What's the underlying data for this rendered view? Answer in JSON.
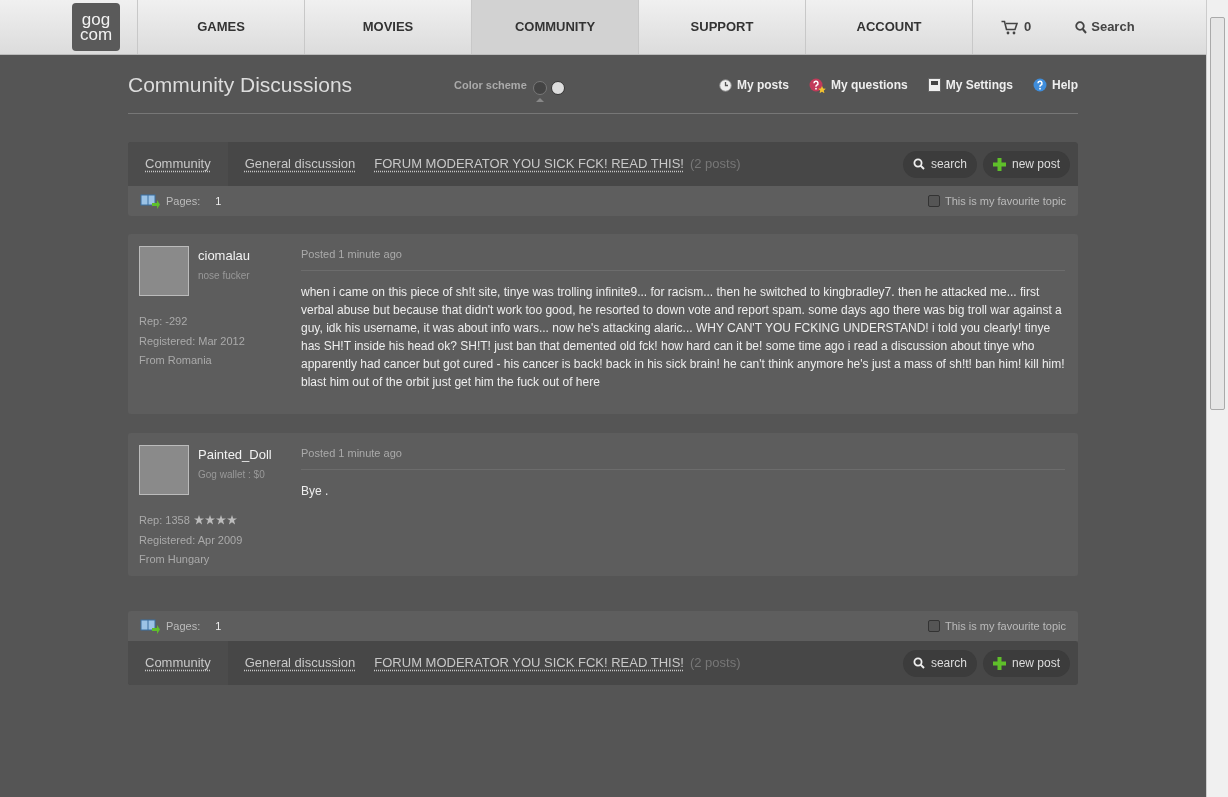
{
  "nav": {
    "logo": [
      "gog",
      "com"
    ],
    "items": [
      {
        "label": "GAMES",
        "selected": false
      },
      {
        "label": "MOVIES",
        "selected": false
      },
      {
        "label": "COMMUNITY",
        "selected": true
      },
      {
        "label": "SUPPORT",
        "selected": false
      },
      {
        "label": "ACCOUNT",
        "selected": false
      }
    ],
    "cart_count": "0",
    "search_label": "Search"
  },
  "header": {
    "title": "Community Discussions",
    "color_scheme": {
      "label": "Color scheme",
      "options": [
        {
          "selected": true
        },
        {
          "selected": false
        }
      ]
    },
    "links": [
      {
        "kind": "posts",
        "label": "My posts"
      },
      {
        "kind": "questions",
        "label": "My questions"
      },
      {
        "kind": "settings",
        "label": "My Settings"
      },
      {
        "kind": "help",
        "label": "Help"
      }
    ]
  },
  "top_nav": {
    "breadcrumbs": [
      "Community",
      "General discussion"
    ],
    "topic": "FORUM MODERATOR YOU SICK FCK! READ THIS!",
    "post_count": "(2 posts)",
    "search_label": "search",
    "new_post_label": "new post",
    "pages_label": "Pages:",
    "page": "1",
    "favourite": {
      "label": "This is my favourite topic",
      "checked": false
    }
  },
  "posts": [
    {
      "username": "ciomalau",
      "subtitle": "nose fucker",
      "rep": "Rep: -292",
      "registered": "Registered: Mar 2012",
      "from": "From Romania",
      "posted": "Posted 1 minute ago",
      "body": "when i came on this piece of sh!t site, tinye was trolling infinite9... for racism... then he switched to kingbradley7. then he attacked me... first verbal abuse but because that didn't work too good, he resorted to down vote and report spam. some days ago there was big troll war against a guy, idk his username, it was about info wars... now he's attacking alaric... WHY CAN'T YOU FCKING UNDERSTAND! i told you clearly! tinye has SH!T inside his head ok? SH!T! just ban that demented old fck! how hard can it be! some time ago i read a discussion about tinye who apparently had cancer but got cured - his cancer is back! back in his sick brain! he can't think anymore he's just a mass of sh!t! ban him! kill him! blast him out of the orbit just get him the fuck out of here"
    },
    {
      "username": "Painted_Doll",
      "subtitle": "Gog wallet : $0",
      "rep": "Rep: 1358",
      "stars": 4,
      "registered": "Registered: Apr 2009",
      "from": "From Hungary",
      "posted": "Posted 1 minute ago",
      "body": "Bye ."
    }
  ],
  "bottom_nav": {
    "breadcrumbs": [
      "Community",
      "General discussion"
    ],
    "topic": "FORUM MODERATOR YOU SICK FCK! READ THIS!",
    "post_count": "(2 posts)",
    "search_label": "search",
    "new_post_label": "new post",
    "pages_label": "Pages:",
    "page": "1",
    "favourite": {
      "label": "This is my favourite topic",
      "checked": false
    }
  }
}
